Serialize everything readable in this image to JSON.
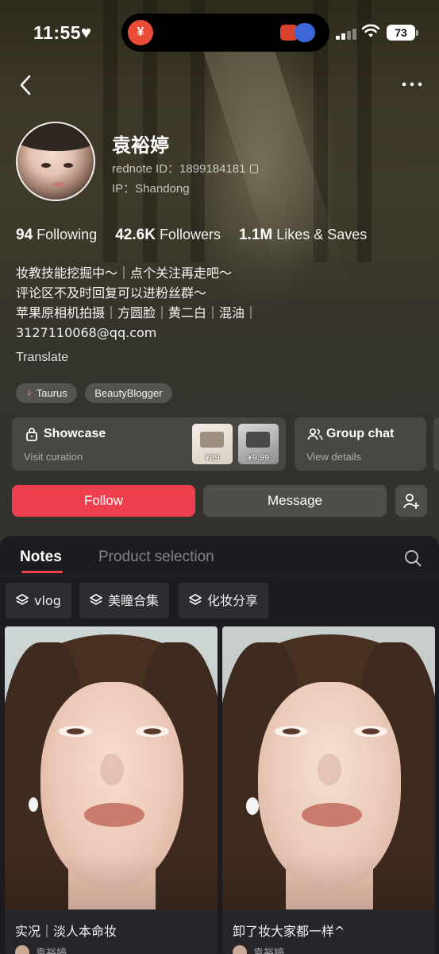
{
  "status_bar": {
    "time": "11:55",
    "battery": "73",
    "heart_icon": "heart-icon",
    "app_icon": "fork-knife-icon"
  },
  "profile": {
    "name": "袁裕婷",
    "rednote_id": "rednote ID：1899184181",
    "ip": "IP：Shandong",
    "stats": [
      {
        "value": "94",
        "label": "Following"
      },
      {
        "value": "42.6K",
        "label": "Followers"
      },
      {
        "value": "1.1M",
        "label": "Likes & Saves"
      }
    ],
    "bio": [
      "妆教技能挖掘中～｜点个关注再走吧～",
      "评论区不及时回复可以进粉丝群～",
      "苹果原相机拍摄｜方圆脸｜黄二白｜混油｜",
      "3127110068@qq.com"
    ],
    "translate": "Translate",
    "tags": [
      "Taurus",
      "BeautyBlogger"
    ]
  },
  "cards": {
    "showcase": {
      "title": "Showcase",
      "subtitle": "Visit curation",
      "prices": [
        "¥39",
        "¥9.99"
      ]
    },
    "group_chat": {
      "title": "Group chat",
      "subtitle": "View details"
    }
  },
  "actions": {
    "follow": "Follow",
    "message": "Message"
  },
  "tabs": {
    "notes": "Notes",
    "product": "Product selection"
  },
  "chips": [
    "vlog",
    "美瞳合集",
    "化妆分享"
  ],
  "notes": [
    {
      "title": "实况｜淡人本命妆",
      "author": "袁裕婷"
    },
    {
      "title": "卸了妆大家都一样^",
      "author": "袁裕婷"
    }
  ],
  "colors": {
    "accent": "#ee3f4f",
    "panel": "#1c1c20"
  }
}
